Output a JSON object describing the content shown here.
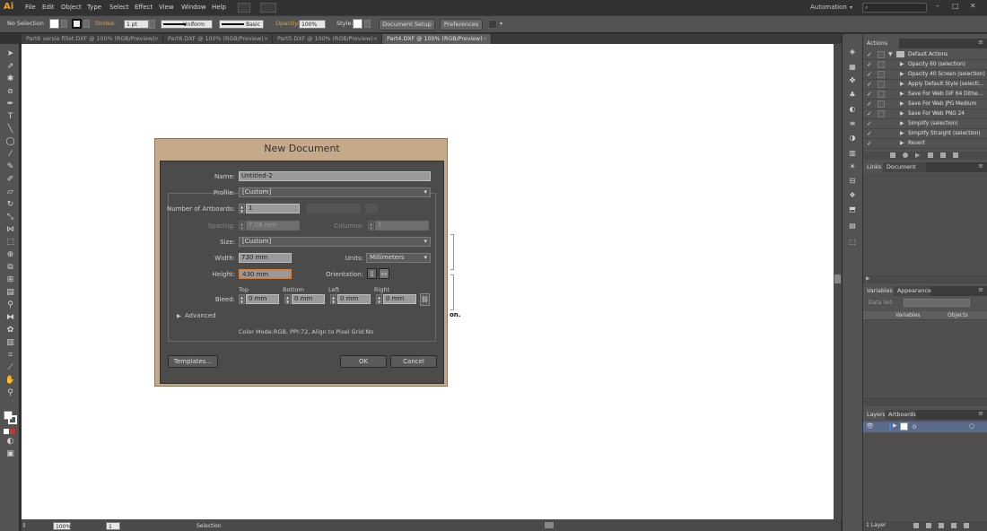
{
  "app": {
    "logo": "Ai",
    "workspace": "Automation",
    "search_placeholder": ""
  },
  "menu": [
    "File",
    "Edit",
    "Object",
    "Type",
    "Select",
    "Effect",
    "View",
    "Window",
    "Help"
  ],
  "control": {
    "selection": "No Selection",
    "stroke_label": "Stroke:",
    "stroke_weight": "1 pt",
    "profile_uniform": "Uniform",
    "brush_basic": "Basic",
    "opacity_label": "Opacity:",
    "opacity_value": "100%",
    "style_label": "Style:",
    "doc_setup": "Document Setup",
    "preferences": "Preferences"
  },
  "tabs": [
    {
      "label": "Part6 versie fillet.DXF @ 100% (RGB/Preview)",
      "active": false
    },
    {
      "label": "Part6.DXF @ 100% (RGB/Preview)",
      "active": false
    },
    {
      "label": "Part5.DXF @ 100% (RGB/Preview)",
      "active": false
    },
    {
      "label": "Part4.DXF @ 100% (RGB/Preview)",
      "active": true
    }
  ],
  "panels": {
    "actions_tab": "Actions",
    "actions": [
      "Default Actions",
      "Opacity 60 (selection)",
      "Opacity 40 Screen (selection)",
      "Apply Default Style (selecti...",
      "Save For Web GIF 64 Dithe...",
      "Save For Web JPG Medium",
      "Save For Web PNG 24",
      "Simplify (selection)",
      "Simplify Straight (selection)",
      "Revert"
    ],
    "links_tab": "Links",
    "docinfo_tab": "Document Info",
    "variables_tab": "Variables",
    "appearance_tab": "Appearance",
    "data_set_label": "Data Set:",
    "col_variables": "Variables",
    "col_objects": "Objects",
    "layers_tab": "Layers",
    "artboards_tab": "Artboards",
    "layer_name": "0",
    "layer_count": "1 Layer"
  },
  "status": {
    "zoom": "100%",
    "artboard_num": "1",
    "tool": "Selection"
  },
  "dialog": {
    "title": "New Document",
    "name_label": "Name:",
    "name_value": "Untitled-2",
    "profile_label": "Profile:",
    "profile_value": "[Custom]",
    "artboards_label": "Number of Artboards:",
    "artboards_value": "1",
    "spacing_label": "Spacing:",
    "spacing_value": "7,06 mm",
    "columns_label": "Columns:",
    "columns_value": "1",
    "size_label": "Size:",
    "size_value": "[Custom]",
    "width_label": "Width:",
    "width_value": "730 mm",
    "units_label": "Units:",
    "units_value": "Millimeters",
    "height_label": "Height:",
    "height_value": "430 mm",
    "orientation_label": "Orientation:",
    "bleed_label": "Bleed:",
    "bleed_top_label": "Top",
    "bleed_bottom_label": "Bottom",
    "bleed_left_label": "Left",
    "bleed_right_label": "Right",
    "bleed_top": "0 mm",
    "bleed_bottom": "0 mm",
    "bleed_left": "0 mm",
    "bleed_right": "0 mm",
    "advanced_label": "Advanced",
    "info": "Color Mode:RGB, PPI:72, Align to Pixel Grid:No",
    "templates_button": "Templates...",
    "ok_button": "OK",
    "cancel_button": "Cancel"
  },
  "canvas_fragment": "on."
}
